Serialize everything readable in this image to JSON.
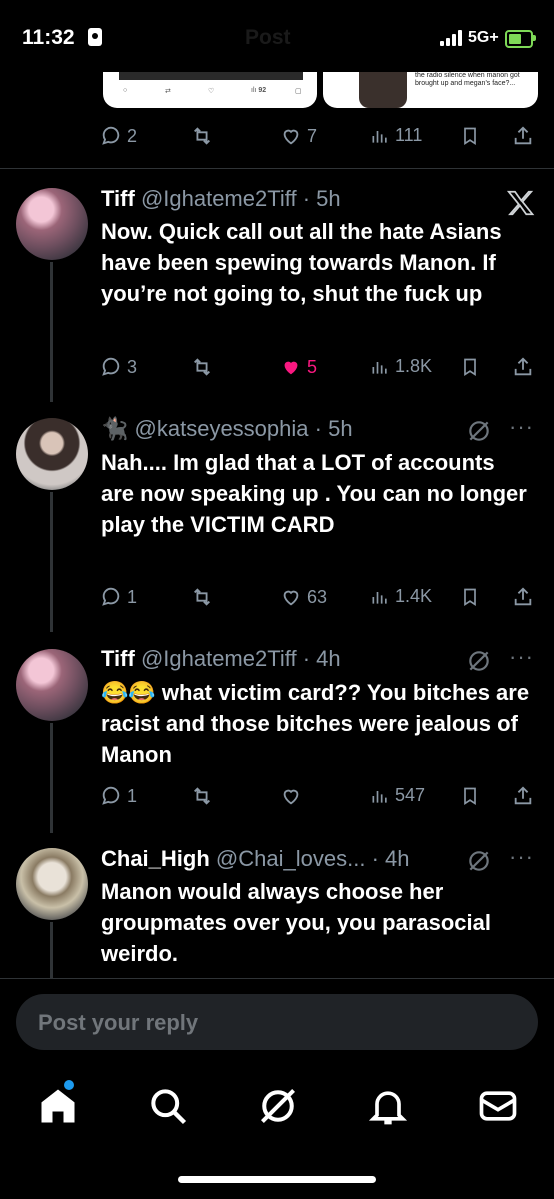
{
  "status_bar": {
    "time": "11:32",
    "network": "5G+",
    "title": "Post"
  },
  "quoted_media": {
    "left_counts": {
      "views": "92"
    },
    "right_caption": "the radio silence when manon got brought up and megan's face?..."
  },
  "main_post_actions": {
    "replies": "2",
    "reposts": "",
    "likes": "7",
    "views": "111"
  },
  "replies": [
    {
      "name": "Tiff",
      "handle": "@Ighateme2Tiff",
      "time": "· 5h",
      "text": "Now. Quick call out all the hate Asians have been spewing towards Manon. If you’re not going to, shut the fuck up",
      "replies": "3",
      "likes": "5",
      "views": "1.8K",
      "liked": true,
      "badge": "x-logo-icon"
    },
    {
      "name": "🐈‍⬛",
      "handle": "@katseyessophia",
      "time": "· 5h",
      "text": "Nah.... Im glad that a LOT of accounts are now speaking up . You can no longer play the VICTIM CARD",
      "replies": "1",
      "likes": "63",
      "views": "1.4K",
      "liked": false
    },
    {
      "name": "Tiff",
      "handle": "@Ighateme2Tiff",
      "time": "· 4h",
      "text": "😂😂 what victim card?? You bitches are racist and those bitches were jealous of Manon",
      "replies": "1",
      "likes": "",
      "views": "547",
      "liked": false
    },
    {
      "name": "Chai_High",
      "handle": "@Chai_loves...",
      "time": "· 4h",
      "text": "Manon would always choose her groupmates over you, you parasocial weirdo.",
      "replies": "",
      "likes": "",
      "views": "",
      "liked": false
    }
  ],
  "reply_input": {
    "placeholder": "Post your reply"
  },
  "nav": [
    "home-icon",
    "search-icon",
    "grok-icon",
    "notifications-icon",
    "messages-icon"
  ],
  "colors": {
    "like": "#f91880",
    "accent": "#1d9bf0",
    "muted": "#8b98a5"
  }
}
